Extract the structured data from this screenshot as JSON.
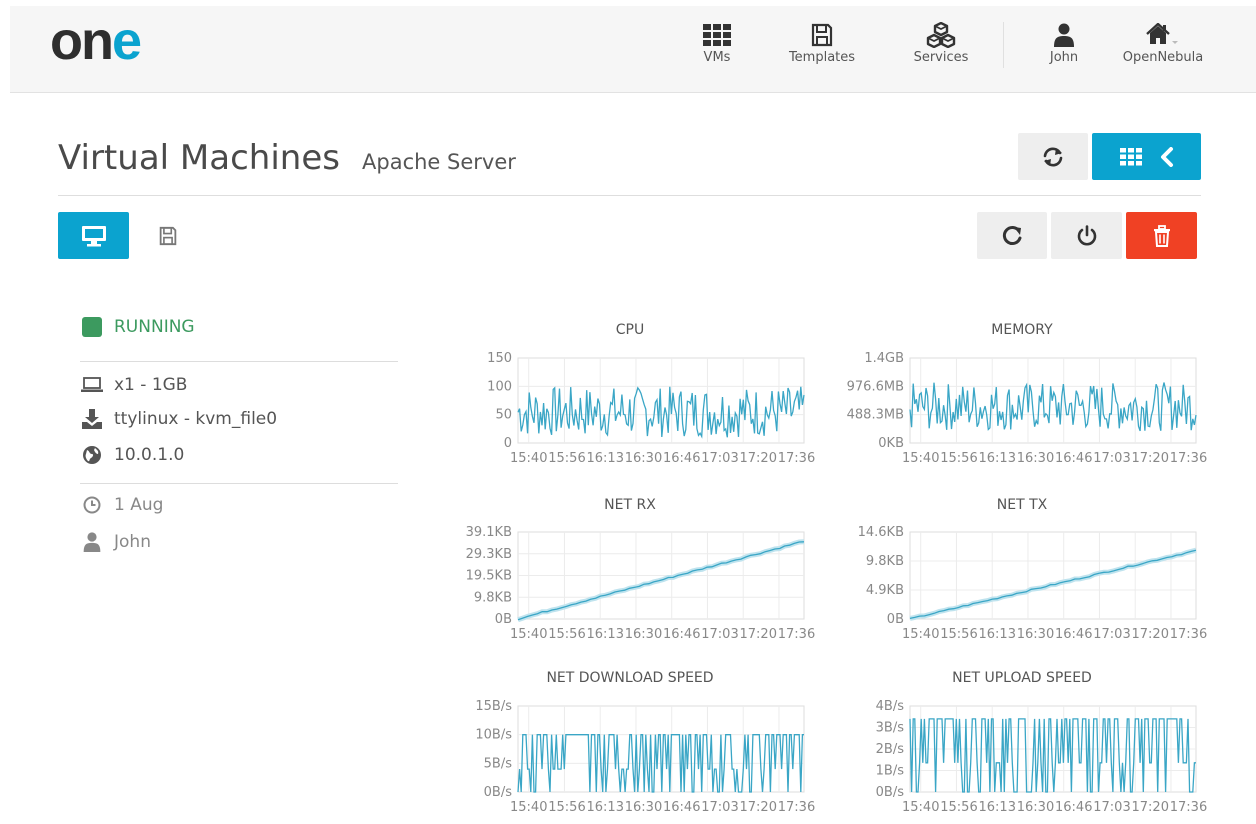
{
  "brand": {
    "logo_letters": [
      "o",
      "n",
      "e"
    ],
    "logo_colors": [
      "#2e2e2e",
      "#2e2e2e",
      "#0ba3cf"
    ]
  },
  "nav": {
    "vms": "VMs",
    "templates": "Templates",
    "services": "Services",
    "user": "John",
    "zone": "OpenNebula"
  },
  "header": {
    "title": "Virtual Machines",
    "subtitle": "Apache Server"
  },
  "icons": {
    "refresh": "refresh-icon",
    "grid": "grid-icon",
    "back": "chevron-left-icon",
    "monitor": "monitor-icon",
    "save": "floppy-icon",
    "reboot": "reboot-icon",
    "power": "power-icon",
    "delete": "trash-icon"
  },
  "vm": {
    "state": "RUNNING",
    "capacity": "x1 - 1GB",
    "disk": "ttylinux - kvm_file0",
    "ip": "10.0.1.0",
    "date": "1 Aug",
    "owner": "John"
  },
  "colors": {
    "accent": "#0ba3cf",
    "running": "#3c9a5f",
    "danger": "#f04124",
    "line": "#3aa6c6"
  },
  "chart_data": [
    {
      "type": "line",
      "title": "CPU",
      "x_tick_labels": [
        "15:40",
        "15:56",
        "16:13",
        "16:30",
        "16:46",
        "17:03",
        "17:20",
        "17:36"
      ],
      "y_tick_labels": [
        "150",
        "100",
        "50",
        "0"
      ],
      "ylim": [
        0,
        150
      ],
      "pattern": "noise",
      "range": [
        10,
        100
      ],
      "grid": true
    },
    {
      "type": "line",
      "title": "MEMORY",
      "x_tick_labels": [
        "15:40",
        "15:56",
        "16:13",
        "16:30",
        "16:46",
        "17:03",
        "17:20",
        "17:36"
      ],
      "y_tick_labels": [
        "1.4GB",
        "976.6MB",
        "488.3MB",
        "0KB"
      ],
      "ylim": [
        0,
        1.4
      ],
      "units": "GB",
      "pattern": "noise",
      "range": [
        0.2,
        1.0
      ],
      "grid": true
    },
    {
      "type": "line",
      "title": "NET RX",
      "x_tick_labels": [
        "15:40",
        "15:56",
        "16:13",
        "16:30",
        "16:46",
        "17:03",
        "17:20",
        "17:36"
      ],
      "y_tick_labels": [
        "39.1KB",
        "29.3KB",
        "19.5KB",
        "9.8KB",
        "0B"
      ],
      "ylim": [
        0,
        39.1
      ],
      "units": "KB",
      "pattern": "rising",
      "range": [
        0,
        35
      ],
      "grid": true
    },
    {
      "type": "line",
      "title": "NET TX",
      "x_tick_labels": [
        "15:40",
        "15:56",
        "16:13",
        "16:30",
        "16:46",
        "17:03",
        "17:20",
        "17:36"
      ],
      "y_tick_labels": [
        "14.6KB",
        "9.8KB",
        "4.9KB",
        "0B"
      ],
      "ylim": [
        0,
        14.6
      ],
      "units": "KB",
      "pattern": "rising",
      "range": [
        0,
        11.5
      ],
      "grid": true
    },
    {
      "type": "line",
      "title": "NET DOWNLOAD SPEED",
      "x_tick_labels": [
        "15:40",
        "15:56",
        "16:13",
        "16:30",
        "16:46",
        "17:03",
        "17:20",
        "17:36"
      ],
      "y_tick_labels": [
        "15B/s",
        "10B/s",
        "5B/s",
        "0B/s"
      ],
      "ylim": [
        0,
        15
      ],
      "units": "B/s",
      "pattern": "square",
      "range": [
        0,
        10
      ],
      "grid": true
    },
    {
      "type": "line",
      "title": "NET UPLOAD SPEED",
      "x_tick_labels": [
        "15:40",
        "15:56",
        "16:13",
        "16:30",
        "16:46",
        "17:03",
        "17:20",
        "17:36"
      ],
      "y_tick_labels": [
        "4B/s",
        "3B/s",
        "2B/s",
        "1B/s",
        "0B/s"
      ],
      "ylim": [
        0,
        4
      ],
      "units": "B/s",
      "pattern": "square",
      "range": [
        0,
        3.4
      ],
      "grid": true
    }
  ]
}
